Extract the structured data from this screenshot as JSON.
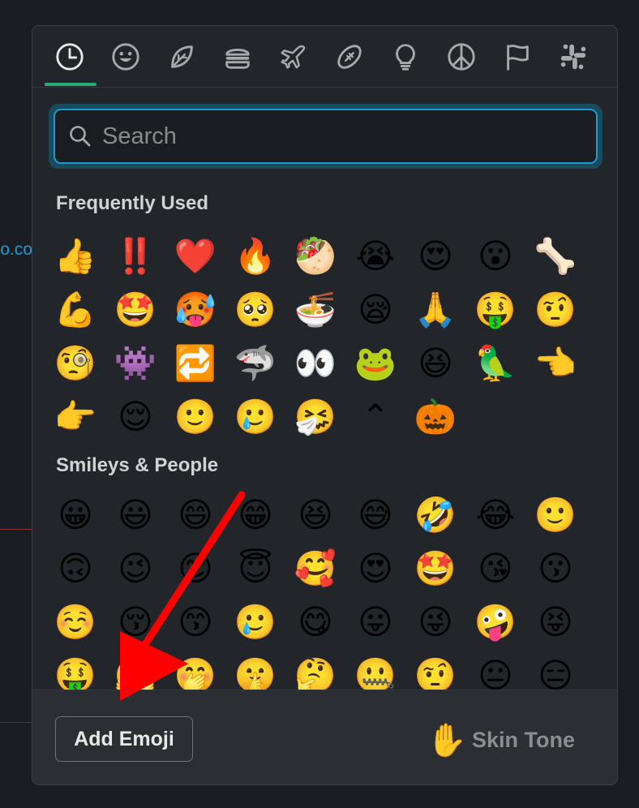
{
  "background": {
    "link_fragment": "o.co"
  },
  "tabs": [
    {
      "name": "recent",
      "icon": "clock-icon"
    },
    {
      "name": "smileys",
      "icon": "smiley-icon"
    },
    {
      "name": "nature",
      "icon": "leaf-icon"
    },
    {
      "name": "food",
      "icon": "burger-icon"
    },
    {
      "name": "travel",
      "icon": "airplane-icon"
    },
    {
      "name": "activities",
      "icon": "football-icon"
    },
    {
      "name": "objects",
      "icon": "lightbulb-icon"
    },
    {
      "name": "symbols",
      "icon": "peace-icon"
    },
    {
      "name": "flags",
      "icon": "flag-icon"
    },
    {
      "name": "custom",
      "icon": "slack-icon"
    }
  ],
  "search": {
    "placeholder": "Search",
    "value": ""
  },
  "sections": {
    "frequent_title": "Frequently Used",
    "smileys_title": "Smileys & People"
  },
  "frequent": [
    "👍",
    "‼️",
    "❤️",
    "🔥",
    "🥙",
    "😭",
    "😍",
    "😮",
    "🦴",
    "💪",
    "🤩",
    "🥵",
    "🥺",
    "🍜",
    "😪",
    "🙏",
    "🤑",
    "🤨",
    "🧐",
    "👾",
    "🔁",
    "🦈",
    "👀",
    "🐸",
    "😆",
    "🦜",
    "👈",
    "👉",
    "😌",
    "🙂",
    "🥲",
    "🤧",
    "⌃",
    "🎃"
  ],
  "smileys": [
    "😀",
    "😃",
    "😄",
    "😁",
    "😆",
    "😅",
    "🤣",
    "😂",
    "🙂",
    "🙃",
    "😉",
    "😊",
    "😇",
    "🥰",
    "😍",
    "🤩",
    "😘",
    "😗",
    "☺️",
    "😚",
    "😙",
    "🥲",
    "😋",
    "😛",
    "😜",
    "🤪",
    "😝",
    "🤑",
    "🤗",
    "🤭",
    "🤫",
    "🤔",
    "🤐",
    "🤨",
    "😐",
    "😑"
  ],
  "footer": {
    "add_label": "Add Emoji",
    "skin_hand": "✋",
    "skin_label": "Skin Tone"
  },
  "colors": {
    "accent_green": "#2bac76",
    "focus_blue": "#1d9bd1",
    "arrow_red": "#ff0000"
  }
}
